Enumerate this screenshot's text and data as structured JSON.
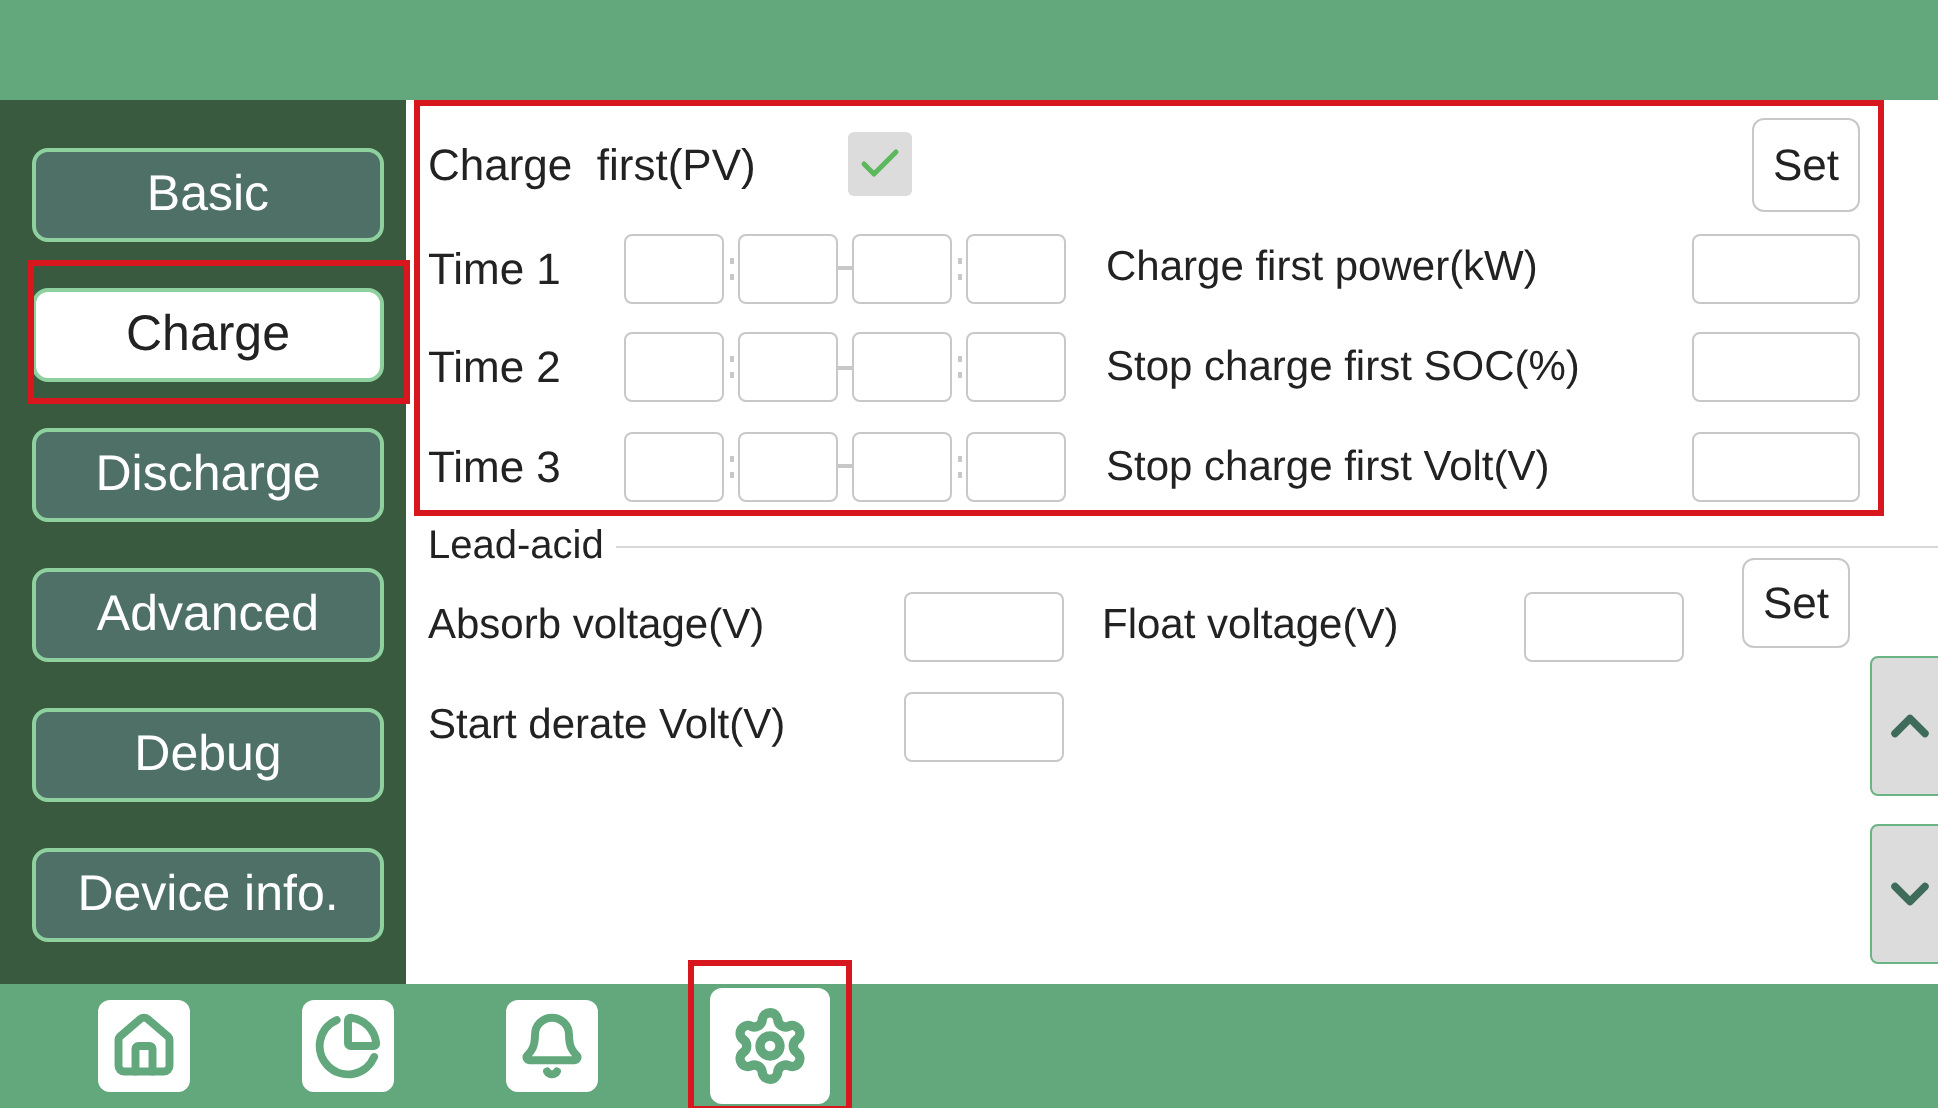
{
  "nav": [
    {
      "label": "Basic",
      "selected": false
    },
    {
      "label": "Charge",
      "selected": true
    },
    {
      "label": "Discharge",
      "selected": false
    },
    {
      "label": "Advanced",
      "selected": false
    },
    {
      "label": "Debug",
      "selected": false
    },
    {
      "label": "Device info.",
      "selected": false
    }
  ],
  "charge_first": {
    "label": "Charge  first(PV)",
    "checked": true,
    "button": "Set",
    "highlight": true
  },
  "time_rows": [
    {
      "label": "Time 1",
      "setting": "Charge first power(kW)"
    },
    {
      "label": "Time 2",
      "setting": "Stop charge first SOC(%)"
    },
    {
      "label": "Time 3",
      "setting": "Stop charge first Volt(V)"
    }
  ],
  "lead_acid": {
    "title": "Lead-acid",
    "absorb": "Absorb voltage(V)",
    "float": "Float voltage(V)",
    "derate": "Start derate Volt(V)",
    "button": "Set"
  },
  "bottom_tabs": [
    {
      "kind": "home",
      "selected": false
    },
    {
      "kind": "chart",
      "selected": false
    },
    {
      "kind": "alarm",
      "selected": false
    },
    {
      "kind": "settings",
      "selected": true
    }
  ]
}
